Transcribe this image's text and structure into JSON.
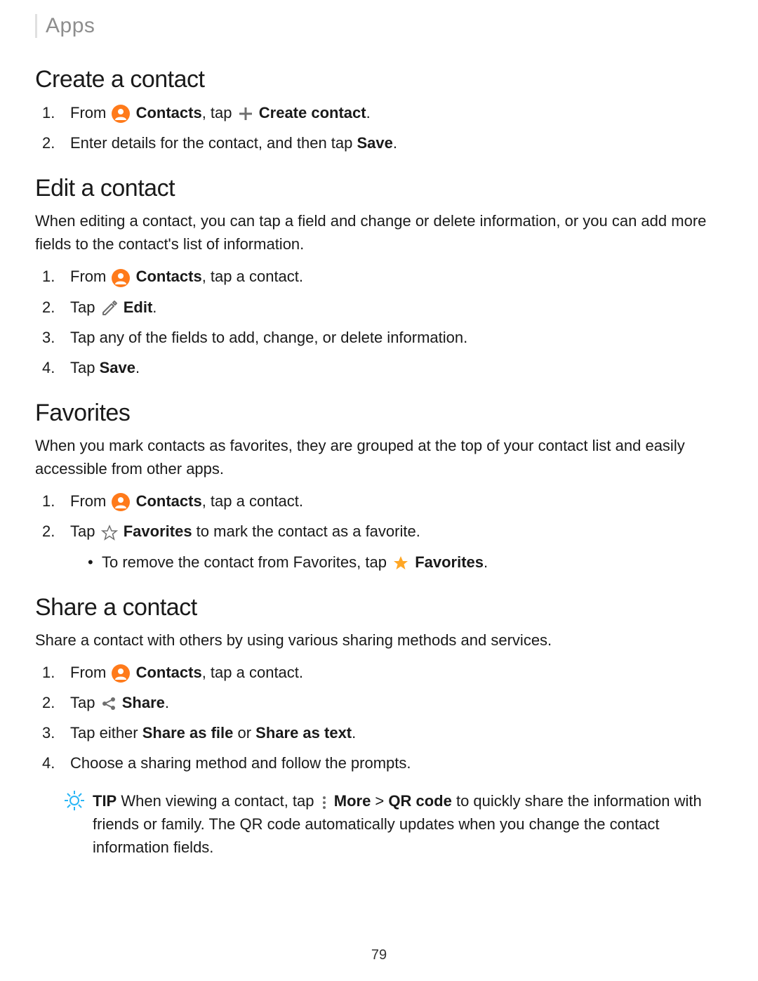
{
  "header": {
    "title": "Apps"
  },
  "sections": {
    "create": {
      "heading": "Create a contact",
      "steps": {
        "s1": {
          "num": "1.",
          "t1": "From",
          "contacts": "Contacts",
          "t2": ", tap",
          "create": "Create contact",
          "t3": "."
        },
        "s2": {
          "num": "2.",
          "t1": "Enter details for the contact, and then tap ",
          "save": "Save",
          "t2": "."
        }
      }
    },
    "edit": {
      "heading": "Edit a contact",
      "intro": "When editing a contact, you can tap a field and change or delete information, or you can add more fields to the contact's list of information.",
      "steps": {
        "s1": {
          "num": "1.",
          "t1": "From",
          "contacts": "Contacts",
          "t2": ", tap a contact."
        },
        "s2": {
          "num": "2.",
          "t1": "Tap",
          "edit": "Edit",
          "t2": "."
        },
        "s3": {
          "num": "3.",
          "text": "Tap any of the fields to add, change, or delete information."
        },
        "s4": {
          "num": "4.",
          "t1": "Tap ",
          "save": "Save",
          "t2": "."
        }
      }
    },
    "favorites": {
      "heading": "Favorites",
      "intro": "When you mark contacts as favorites, they are grouped at the top of your contact list and easily accessible from other apps.",
      "steps": {
        "s1": {
          "num": "1.",
          "t1": "From",
          "contacts": "Contacts",
          "t2": ", tap a contact."
        },
        "s2": {
          "num": "2.",
          "t1": "Tap",
          "favlabel": "Favorites",
          "t2": " to mark the contact as a favorite.",
          "sub": {
            "t1": "To remove the contact from Favorites, tap",
            "favlabel": "Favorites",
            "t2": "."
          }
        }
      }
    },
    "share": {
      "heading": "Share a contact",
      "intro": "Share a contact with others by using various sharing methods and services.",
      "steps": {
        "s1": {
          "num": "1.",
          "t1": "From",
          "contacts": "Contacts",
          "t2": ", tap a contact."
        },
        "s2": {
          "num": "2.",
          "t1": "Tap",
          "share": "Share",
          "t2": "."
        },
        "s3": {
          "num": "3.",
          "t1": "Tap either ",
          "opt1": "Share as file",
          "t2": " or ",
          "opt2": "Share as text",
          "t3": "."
        },
        "s4": {
          "num": "4.",
          "text": "Choose a sharing method and follow the prompts."
        }
      },
      "tip": {
        "label": "TIP",
        "t1": "  When viewing a contact, tap",
        "more": "More",
        "gt": " > ",
        "qr": "QR code",
        "t2": " to quickly share the information with friends or family. The QR code automatically updates when you change the contact information fields."
      }
    }
  },
  "page_number": "79"
}
